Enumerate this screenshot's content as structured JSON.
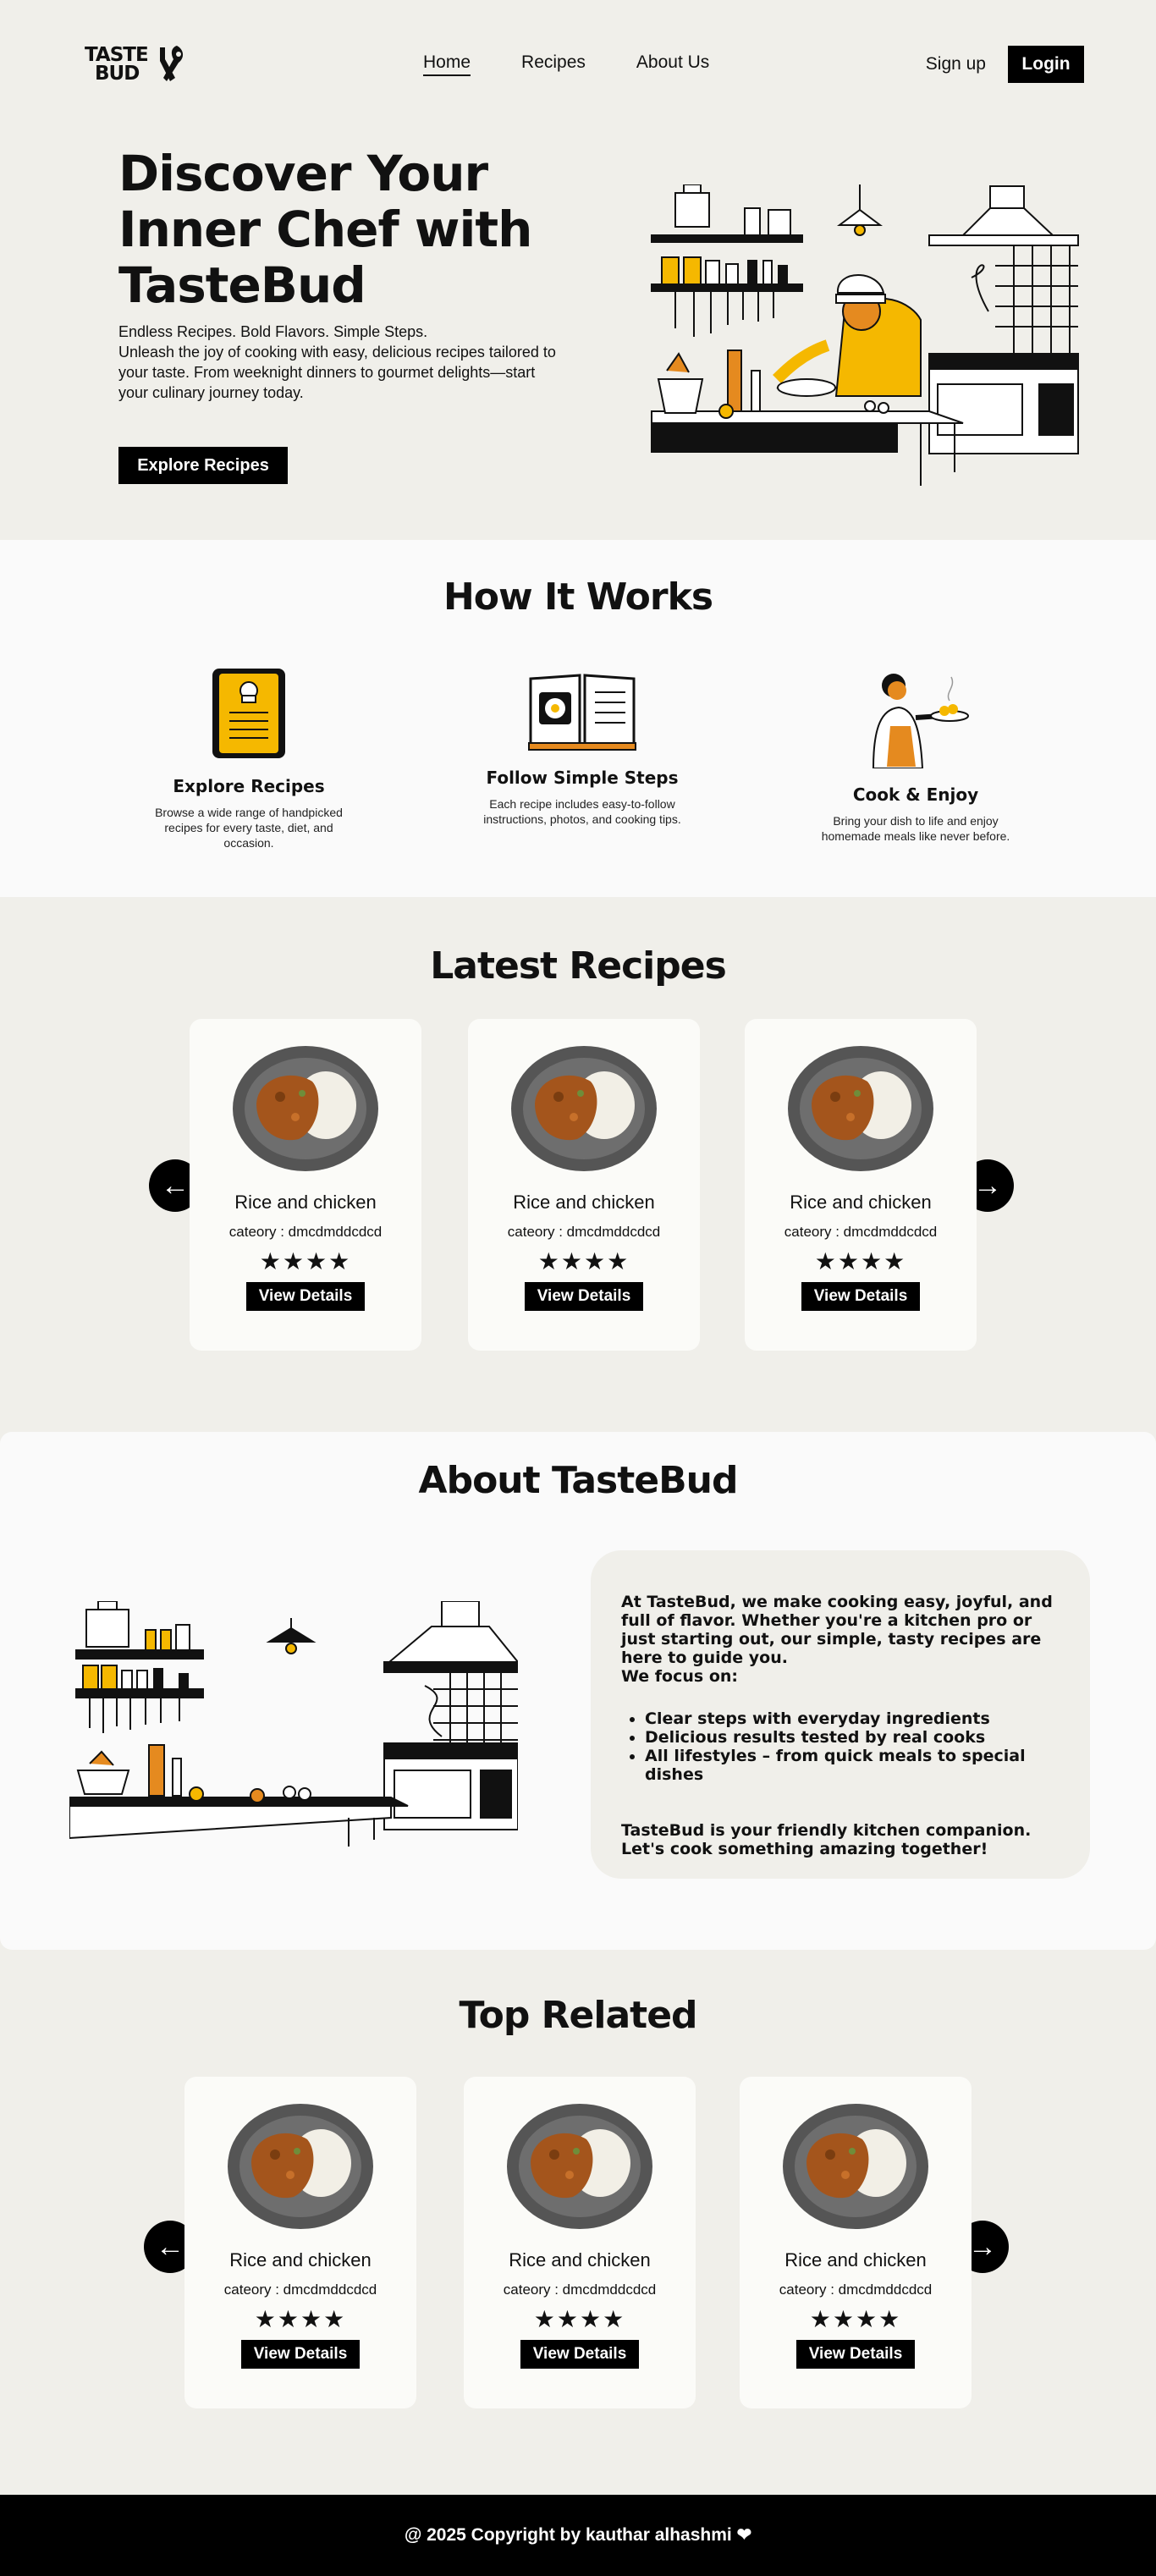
{
  "brand": {
    "logo_line1": "TASTE",
    "logo_line2": "BUD"
  },
  "nav": {
    "links": [
      {
        "label": "Home",
        "active": true
      },
      {
        "label": "Recipes",
        "active": false
      },
      {
        "label": "About Us",
        "active": false
      }
    ],
    "signup_label": "Sign up",
    "login_label": "Login"
  },
  "hero": {
    "title": "Discover Your Inner Chef with TasteBud",
    "subtitle": "Endless Recipes. Bold Flavors. Simple Steps.",
    "description": "Unleash the joy of cooking with easy, delicious recipes tailored to your taste. From weeknight dinners to gourmet delights—start your culinary journey today.",
    "cta_label": "Explore Recipes"
  },
  "how_it_works": {
    "title": "How It Works",
    "steps": [
      {
        "title": "Explore Recipes",
        "desc": "Browse a wide range of handpicked recipes for every taste, diet, and occasion.",
        "icon": "tablet-chef-icon"
      },
      {
        "title": "Follow Simple Steps",
        "desc": "Each recipe includes easy-to-follow instructions, photos, and cooking tips.",
        "icon": "open-book-icon"
      },
      {
        "title": "Cook & Enjoy",
        "desc": "Bring your dish to life and enjoy homemade meals like never before.",
        "icon": "woman-serving-dish-icon"
      }
    ]
  },
  "latest_recipes": {
    "title": "Latest Recipes",
    "cards": [
      {
        "name": "Rice and chicken",
        "category": "cateory : dmcdmddcdcd",
        "rating": 4,
        "stars": "★★★★",
        "button": "View Details"
      },
      {
        "name": "Rice and chicken",
        "category": "cateory : dmcdmddcdcd",
        "rating": 4,
        "stars": "★★★★",
        "button": "View Details"
      },
      {
        "name": "Rice and chicken",
        "category": "cateory : dmcdmddcdcd",
        "rating": 4,
        "stars": "★★★★",
        "button": "View Details"
      }
    ]
  },
  "about": {
    "title": "About TasteBud",
    "intro": "At TasteBud, we make cooking easy, joyful, and full of flavor. Whether you're a kitchen pro or just starting out, our simple, tasty recipes are here to guide you.",
    "focus_label": "We focus on:",
    "bullets": [
      "Clear steps with everyday ingredients",
      "Delicious results tested by real cooks",
      "All lifestyles – from quick meals to special dishes"
    ],
    "outro": "TasteBud is your friendly kitchen companion. Let's cook something amazing together!"
  },
  "top_related": {
    "title": "Top Related",
    "cards": [
      {
        "name": "Rice and chicken",
        "category": "cateory : dmcdmddcdcd",
        "rating": 4,
        "stars": "★★★★",
        "button": "View Details"
      },
      {
        "name": "Rice and chicken",
        "category": "cateory : dmcdmddcdcd",
        "rating": 4,
        "stars": "★★★★",
        "button": "View Details"
      },
      {
        "name": "Rice and chicken",
        "category": "cateory : dmcdmddcdcd",
        "rating": 4,
        "stars": "★★★★",
        "button": "View Details"
      }
    ]
  },
  "arrows": {
    "prev": "←",
    "next": "→"
  },
  "footer": {
    "text": "@ 2025 Copyright by kauthar alhashmi ❤"
  },
  "colors": {
    "background": "#f0efea",
    "section_light": "#fafafa",
    "accent_yellow": "#f5b800",
    "accent_orange": "#e58a1f",
    "black": "#000000"
  }
}
